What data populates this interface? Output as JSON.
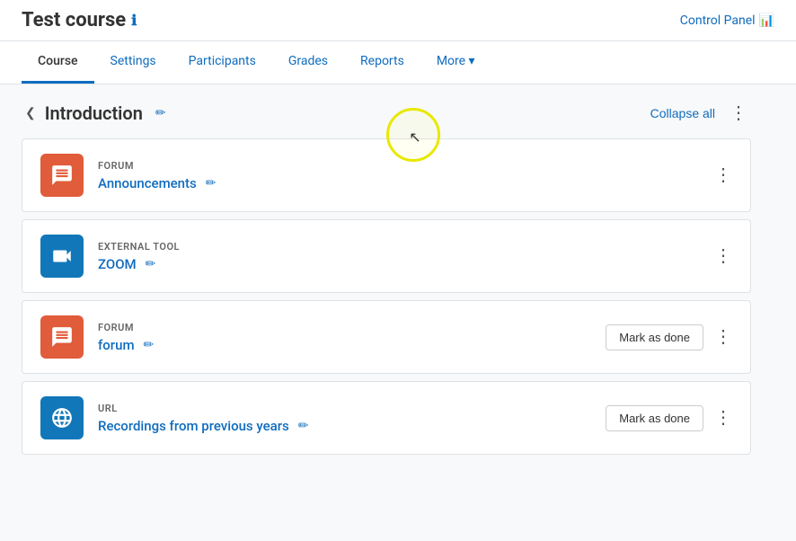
{
  "header": {
    "course_title": "Test course",
    "info_icon": "ℹ",
    "control_panel_label": "Control Panel",
    "chart_icon": "📊"
  },
  "nav": {
    "items": [
      {
        "label": "Course",
        "active": true
      },
      {
        "label": "Settings",
        "active": false
      },
      {
        "label": "Participants",
        "active": false
      },
      {
        "label": "Grades",
        "active": false
      },
      {
        "label": "Reports",
        "active": false
      },
      {
        "label": "More",
        "active": false,
        "has_dropdown": true
      }
    ]
  },
  "section": {
    "title": "Introduction",
    "collapse_all_label": "Collapse all",
    "activities": [
      {
        "id": 1,
        "type": "FORUM",
        "name": "Announcements",
        "icon_type": "forum",
        "icon_color": "orange",
        "show_mark_done": false
      },
      {
        "id": 2,
        "type": "EXTERNAL TOOL",
        "name": "ZOOM",
        "icon_type": "zoom",
        "icon_color": "blue",
        "show_mark_done": false
      },
      {
        "id": 3,
        "type": "FORUM",
        "name": "forum",
        "icon_type": "forum",
        "icon_color": "orange",
        "show_mark_done": true,
        "mark_done_label": "Mark as done"
      },
      {
        "id": 4,
        "type": "URL",
        "name": "Recordings from previous years",
        "icon_type": "url",
        "icon_color": "blue",
        "show_mark_done": true,
        "mark_done_label": "Mark as done"
      }
    ]
  }
}
